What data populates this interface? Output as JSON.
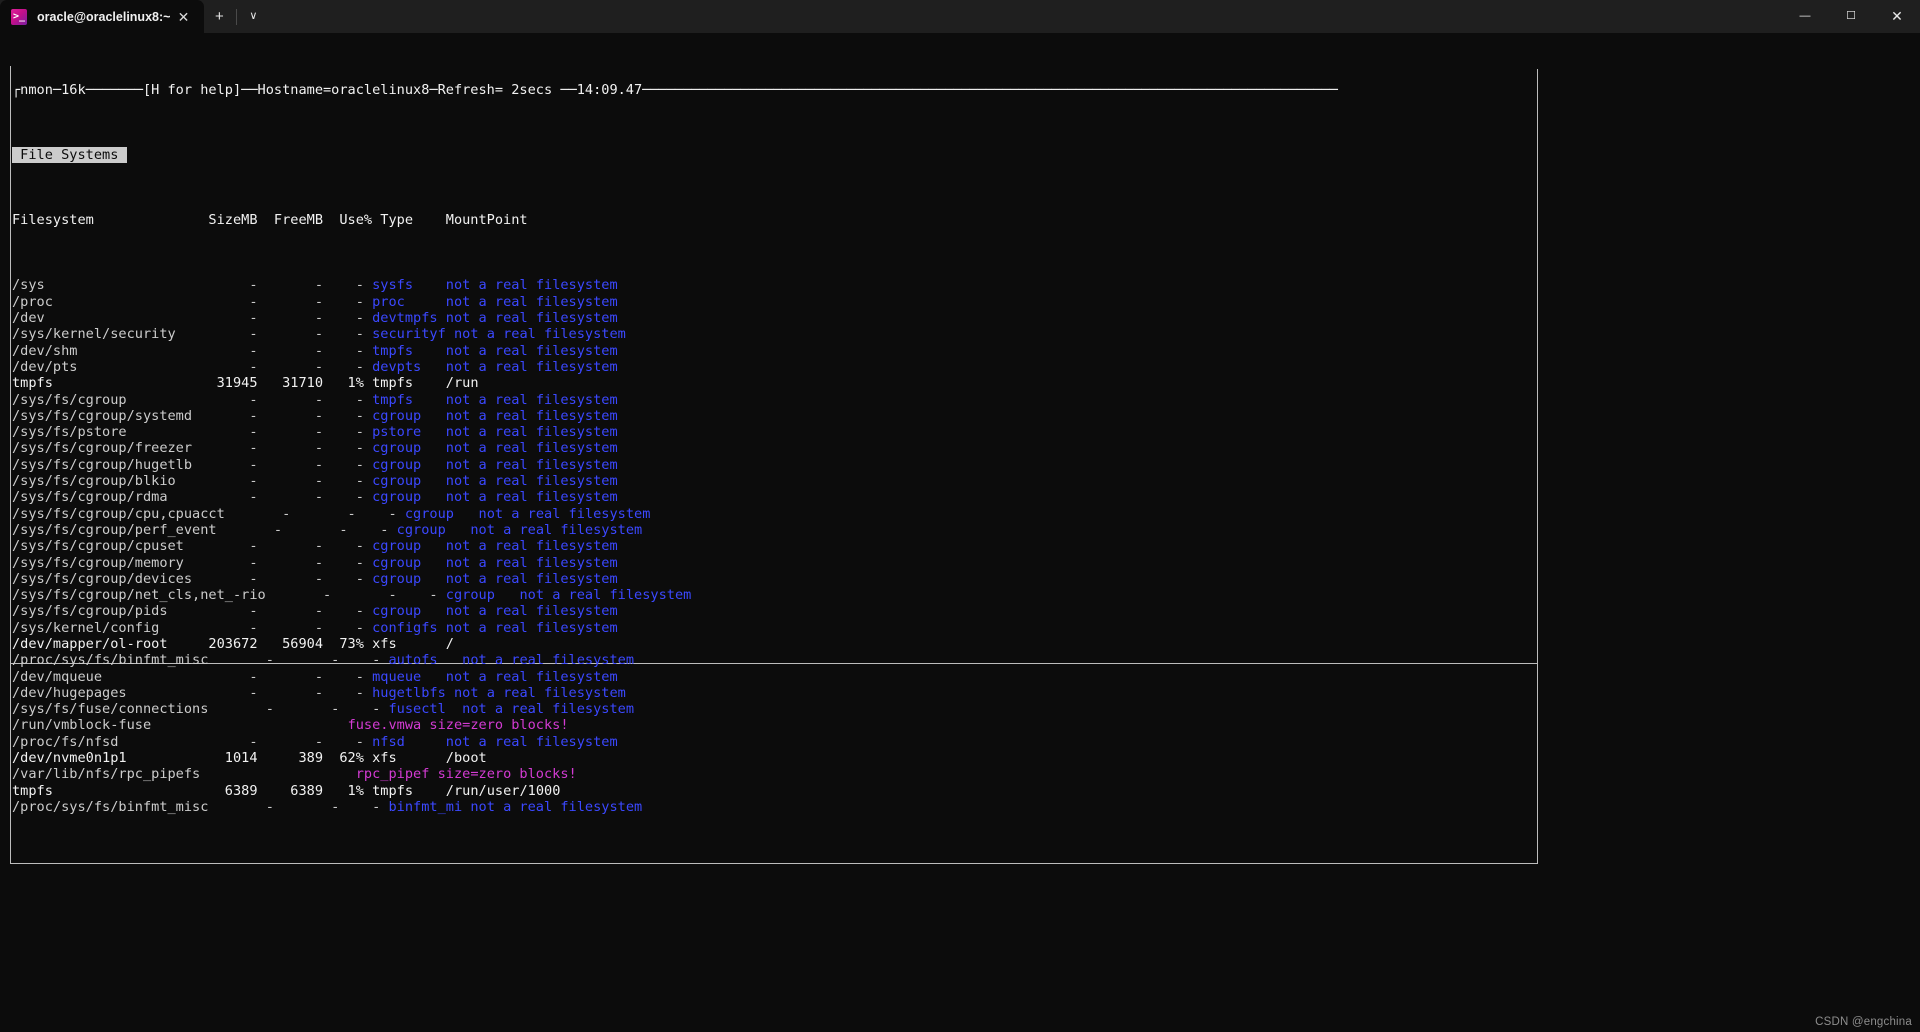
{
  "window": {
    "tab": {
      "title": "oracle@oraclelinux8:~",
      "icon": "terminal-icon",
      "icon_glyph": "⬚",
      "close_label": "✕"
    },
    "new_tab_label": "+",
    "tab_dropdown_label": "∨",
    "controls": {
      "minimize": "—",
      "maximize": "☐",
      "close": "✕"
    }
  },
  "watermark": "CSDN @engchina",
  "colors": {
    "terminal_bg": "#0c0c0c",
    "titlebar_bg": "#1f1f1f",
    "text_default": "#cccccc",
    "pseudo_fs": "#3b48ff",
    "warning": "#d33bd3",
    "frame": "#bdbdbd"
  },
  "nmon": {
    "header": {
      "name": "nmon",
      "version": "16k",
      "help_hint": "[H for help]",
      "hostname_label": "Hostname=",
      "hostname": "oraclelinux8",
      "refresh_label": "Refresh=",
      "refresh_value": " 2secs",
      "time": "14:09.47",
      "line": "┌nmon─16k───────[H for help]──Hostname=oraclelinux8─Refresh= 2secs ──14:09.47─────────────────────────────────────────────────────────────────────────────────────"
    },
    "section_title": " File Systems ",
    "columns": {
      "filesystem": "Filesystem",
      "sizemb": "SizeMB",
      "freemb": "FreeMB",
      "usepct": "Use%",
      "type": "Type",
      "mountpoint": "MountPoint"
    },
    "header_row": "Filesystem              SizeMB  FreeMB  Use% Type    MountPoint",
    "not_real": "not a real filesystem",
    "size_zero": "size=zero blocks!",
    "rows": [
      {
        "fs": "/sys",
        "size": "-",
        "free": "-",
        "use": "-",
        "type": "sysfs",
        "mount": "not a real filesystem",
        "real": false,
        "style": "pseudo"
      },
      {
        "fs": "/proc",
        "size": "-",
        "free": "-",
        "use": "-",
        "type": "proc",
        "mount": "not a real filesystem",
        "real": false,
        "style": "pseudo"
      },
      {
        "fs": "/dev",
        "size": "-",
        "free": "-",
        "use": "-",
        "type": "devtmpfs",
        "mount": "not a real filesystem",
        "real": false,
        "style": "pseudo"
      },
      {
        "fs": "/sys/kernel/security",
        "size": "-",
        "free": "-",
        "use": "-",
        "type": "securityf",
        "mount": "not a real filesystem",
        "real": false,
        "style": "pseudo"
      },
      {
        "fs": "/dev/shm",
        "size": "-",
        "free": "-",
        "use": "-",
        "type": "tmpfs",
        "mount": "not a real filesystem",
        "real": false,
        "style": "pseudo"
      },
      {
        "fs": "/dev/pts",
        "size": "-",
        "free": "-",
        "use": "-",
        "type": "devpts",
        "mount": "not a real filesystem",
        "real": false,
        "style": "pseudo"
      },
      {
        "fs": "tmpfs",
        "size": "31945",
        "free": "31710",
        "use": "1%",
        "type": "tmpfs",
        "mount": "/run",
        "real": true,
        "style": "real"
      },
      {
        "fs": "/sys/fs/cgroup",
        "size": "-",
        "free": "-",
        "use": "-",
        "type": "tmpfs",
        "mount": "not a real filesystem",
        "real": false,
        "style": "pseudo"
      },
      {
        "fs": "/sys/fs/cgroup/systemd",
        "size": "-",
        "free": "-",
        "use": "-",
        "type": "cgroup",
        "mount": "not a real filesystem",
        "real": false,
        "style": "pseudo"
      },
      {
        "fs": "/sys/fs/pstore",
        "size": "-",
        "free": "-",
        "use": "-",
        "type": "pstore",
        "mount": "not a real filesystem",
        "real": false,
        "style": "pseudo"
      },
      {
        "fs": "/sys/fs/cgroup/freezer",
        "size": "-",
        "free": "-",
        "use": "-",
        "type": "cgroup",
        "mount": "not a real filesystem",
        "real": false,
        "style": "pseudo"
      },
      {
        "fs": "/sys/fs/cgroup/hugetlb",
        "size": "-",
        "free": "-",
        "use": "-",
        "type": "cgroup",
        "mount": "not a real filesystem",
        "real": false,
        "style": "pseudo"
      },
      {
        "fs": "/sys/fs/cgroup/blkio",
        "size": "-",
        "free": "-",
        "use": "-",
        "type": "cgroup",
        "mount": "not a real filesystem",
        "real": false,
        "style": "pseudo"
      },
      {
        "fs": "/sys/fs/cgroup/rdma",
        "size": "-",
        "free": "-",
        "use": "-",
        "type": "cgroup",
        "mount": "not a real filesystem",
        "real": false,
        "style": "pseudo"
      },
      {
        "fs": "/sys/fs/cgroup/cpu,cpuacct",
        "size": "-",
        "free": "-",
        "use": "-",
        "type": "cgroup",
        "mount": "not a real filesystem",
        "real": false,
        "style": "pseudo"
      },
      {
        "fs": "/sys/fs/cgroup/perf_event",
        "size": "-",
        "free": "-",
        "use": "-",
        "type": "cgroup",
        "mount": "not a real filesystem",
        "real": false,
        "style": "pseudo"
      },
      {
        "fs": "/sys/fs/cgroup/cpuset",
        "size": "-",
        "free": "-",
        "use": "-",
        "type": "cgroup",
        "mount": "not a real filesystem",
        "real": false,
        "style": "pseudo"
      },
      {
        "fs": "/sys/fs/cgroup/memory",
        "size": "-",
        "free": "-",
        "use": "-",
        "type": "cgroup",
        "mount": "not a real filesystem",
        "real": false,
        "style": "pseudo"
      },
      {
        "fs": "/sys/fs/cgroup/devices",
        "size": "-",
        "free": "-",
        "use": "-",
        "type": "cgroup",
        "mount": "not a real filesystem",
        "real": false,
        "style": "pseudo"
      },
      {
        "fs": "/sys/fs/cgroup/net_cls,net_-rio",
        "size": "-",
        "free": "-",
        "use": "-",
        "type": "cgroup",
        "mount": "not a real filesystem",
        "real": false,
        "style": "pseudo"
      },
      {
        "fs": "/sys/fs/cgroup/pids",
        "size": "-",
        "free": "-",
        "use": "-",
        "type": "cgroup",
        "mount": "not a real filesystem",
        "real": false,
        "style": "pseudo"
      },
      {
        "fs": "/sys/kernel/config",
        "size": "-",
        "free": "-",
        "use": "-",
        "type": "configfs",
        "mount": "not a real filesystem",
        "real": false,
        "style": "pseudo"
      },
      {
        "fs": "/dev/mapper/ol-root",
        "size": "203672",
        "free": "56904",
        "use": "73%",
        "type": "xfs",
        "mount": "/",
        "real": true,
        "style": "real"
      },
      {
        "fs": "/proc/sys/fs/binfmt_misc",
        "size": "-",
        "free": "-",
        "use": "-",
        "type": "autofs",
        "mount": "not a real filesystem",
        "real": false,
        "style": "pseudo"
      },
      {
        "fs": "/dev/mqueue",
        "size": "-",
        "free": "-",
        "use": "-",
        "type": "mqueue",
        "mount": "not a real filesystem",
        "real": false,
        "style": "pseudo"
      },
      {
        "fs": "/dev/hugepages",
        "size": "-",
        "free": "-",
        "use": "-",
        "type": "hugetlbfs",
        "mount": "not a real filesystem",
        "real": false,
        "style": "pseudo"
      },
      {
        "fs": "/sys/fs/fuse/connections",
        "size": "-",
        "free": "-",
        "use": "-",
        "type": "fusectl",
        "mount": "not a real filesystem",
        "real": false,
        "style": "pseudo"
      },
      {
        "fs": "/run/vmblock-fuse",
        "size": "",
        "free": "",
        "use": "",
        "type": "fuse.vmwa",
        "mount": "size=zero blocks!",
        "real": false,
        "style": "zero"
      },
      {
        "fs": "/proc/fs/nfsd",
        "size": "-",
        "free": "-",
        "use": "-",
        "type": "nfsd",
        "mount": "not a real filesystem",
        "real": false,
        "style": "pseudo"
      },
      {
        "fs": "/dev/nvme0n1p1",
        "size": "1014",
        "free": "389",
        "use": "62%",
        "type": "xfs",
        "mount": "/boot",
        "real": true,
        "style": "real"
      },
      {
        "fs": "/var/lib/nfs/rpc_pipefs",
        "size": "",
        "free": "",
        "use": "",
        "type": "rpc_pipef",
        "mount": "size=zero blocks!",
        "real": false,
        "style": "zero"
      },
      {
        "fs": "tmpfs",
        "size": "6389",
        "free": "6389",
        "use": "1%",
        "type": "tmpfs",
        "mount": "/run/user/1000",
        "real": true,
        "style": "real"
      },
      {
        "fs": "/proc/sys/fs/binfmt_misc",
        "size": "-",
        "free": "-",
        "use": "-",
        "type": "binfmt_mi",
        "mount": "not a real filesystem",
        "real": false,
        "style": "pseudo"
      }
    ]
  }
}
